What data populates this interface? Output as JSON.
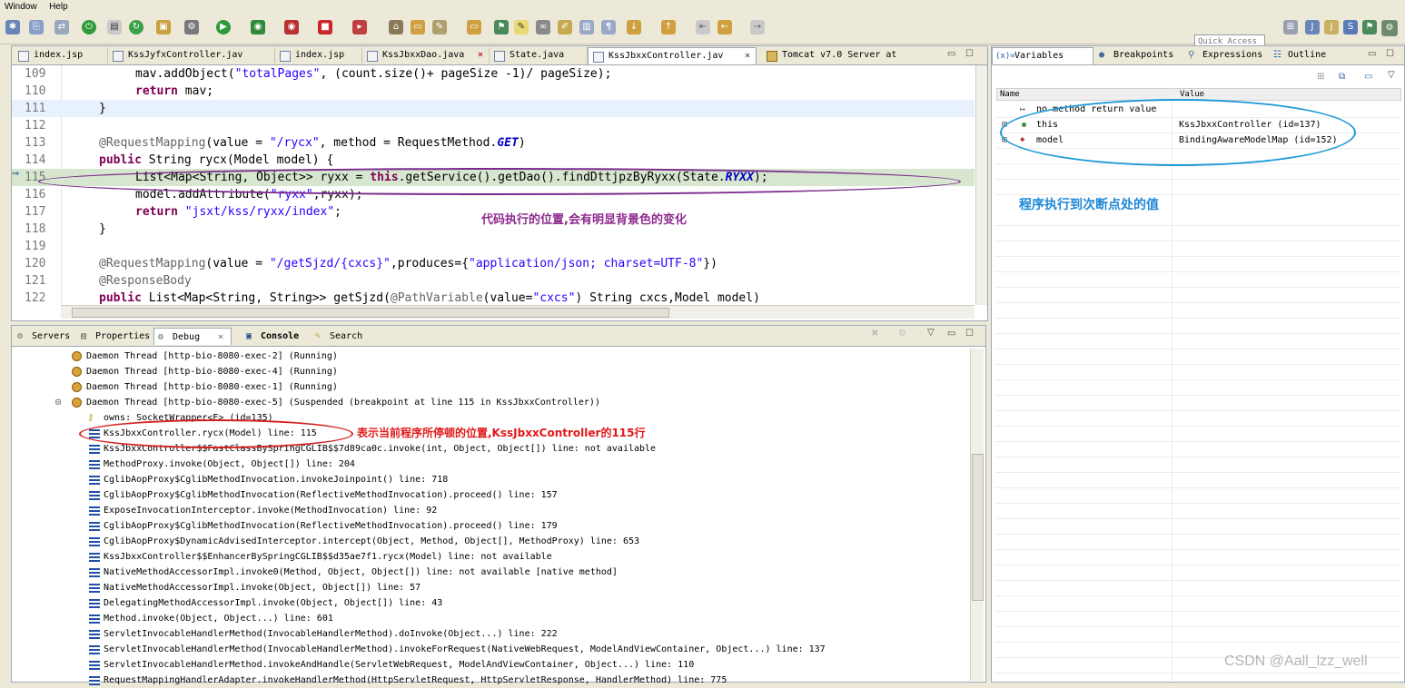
{
  "menu": [
    "Window",
    "Help"
  ],
  "quick_access": "Quick Access",
  "editor": {
    "tabs": [
      {
        "label": "index.jsp"
      },
      {
        "label": "KssJyfxController.jav"
      },
      {
        "label": "index.jsp"
      },
      {
        "label": "KssJbxxDao.java"
      },
      {
        "label": "State.java"
      },
      {
        "label": "KssJbxxController.jav"
      },
      {
        "label": "Tomcat v7.0 Server at"
      }
    ],
    "lines": [
      {
        "n": "109",
        "code": "    mav.addObject(\"totalPages\", (count.size()+ pageSize -1)/ pageSize);"
      },
      {
        "n": "110",
        "code": "    return mav;"
      },
      {
        "n": "111",
        "code": "}"
      },
      {
        "n": "112",
        "code": ""
      },
      {
        "n": "113",
        "code": "@RequestMapping(value = \"/rycx\", method = RequestMethod.GET)"
      },
      {
        "n": "114",
        "code": "public String rycx(Model model) {"
      },
      {
        "n": "115",
        "code": "    List<Map<String, Object>> ryxx = this.getService().getDao().findDttjpzByRyxx(State.RYXX);"
      },
      {
        "n": "116",
        "code": "    model.addAttribute(\"ryxx\",ryxx);"
      },
      {
        "n": "117",
        "code": "    return \"jsxt/kss/ryxx/index\";"
      },
      {
        "n": "118",
        "code": "}"
      },
      {
        "n": "119",
        "code": ""
      },
      {
        "n": "120",
        "code": "@RequestMapping(value = \"/getSjzd/{cxcs}\",produces={\"application/json; charset=UTF-8\"})"
      },
      {
        "n": "121",
        "code": "@ResponseBody"
      },
      {
        "n": "122",
        "code": "public List<Map<String, String>> getSjzd(@PathVariable(value=\"cxcs\") String cxcs,Model model)"
      }
    ],
    "annotation": "代码执行的位置,会有明显背景色的变化"
  },
  "variables": {
    "tabs": [
      "Variables",
      "Breakpoints",
      "Expressions",
      "Outline"
    ],
    "columns": {
      "name": "Name",
      "value": "Value"
    },
    "rows": [
      {
        "name": "no method return value",
        "value": ""
      },
      {
        "name": "this",
        "value": "KssJbxxController  (id=137)"
      },
      {
        "name": "model",
        "value": "BindingAwareModelMap  (id=152)"
      }
    ],
    "annotation": "程序执行到次断点处的值"
  },
  "debug": {
    "tabs": [
      "Servers",
      "Properties",
      "Debug",
      "Console",
      "Search"
    ],
    "threads": [
      "Daemon Thread [http-bio-8080-exec-2] (Running)",
      "Daemon Thread [http-bio-8080-exec-4] (Running)",
      "Daemon Thread [http-bio-8080-exec-1] (Running)",
      "Daemon Thread [http-bio-8080-exec-5] (Suspended (breakpoint at line 115 in KssJbxxController))"
    ],
    "owns": "owns: SocketWrapper<E>  (id=135)",
    "frames": [
      "KssJbxxController.rycx(Model) line: 115",
      "KssJbxxController$$FastClassBySpringCGLIB$$7d89ca0c.invoke(int, Object, Object[]) line: not available",
      "MethodProxy.invoke(Object, Object[]) line: 204",
      "CglibAopProxy$CglibMethodInvocation.invokeJoinpoint() line: 718",
      "CglibAopProxy$CglibMethodInvocation(ReflectiveMethodInvocation).proceed() line: 157",
      "ExposeInvocationInterceptor.invoke(MethodInvocation) line: 92",
      "CglibAopProxy$CglibMethodInvocation(ReflectiveMethodInvocation).proceed() line: 179",
      "CglibAopProxy$DynamicAdvisedInterceptor.intercept(Object, Method, Object[], MethodProxy) line: 653",
      "KssJbxxController$$EnhancerBySpringCGLIB$$d35ae7f1.rycx(Model) line: not available",
      "NativeMethodAccessorImpl.invoke0(Method, Object, Object[]) line: not available [native method]",
      "NativeMethodAccessorImpl.invoke(Object, Object[]) line: 57",
      "DelegatingMethodAccessorImpl.invoke(Object, Object[]) line: 43",
      "Method.invoke(Object, Object...) line: 601",
      "ServletInvocableHandlerMethod(InvocableHandlerMethod).doInvoke(Object...) line: 222",
      "ServletInvocableHandlerMethod(InvocableHandlerMethod).invokeForRequest(NativeWebRequest, ModelAndViewContainer, Object...) line: 137",
      "ServletInvocableHandlerMethod.invokeAndHandle(ServletWebRequest, ModelAndViewContainer, Object...) line: 110",
      "RequestMappingHandlerAdapter.invokeHandlerMethod(HttpServletRequest, HttpServletResponse, HandlerMethod) line: 775"
    ],
    "annotation": "表示当前程序所停顿的位置,KssJbxxController的115行"
  },
  "watermark": "CSDN @Aall_lzz_well",
  "colors": {
    "purple_oval": "#7b2a8c",
    "blue_oval": "#1e9ad6",
    "red_oval": "#d42020",
    "purple_note": "#8e2a8f",
    "blue_note": "#1e88d6",
    "red_note": "#e01818"
  }
}
